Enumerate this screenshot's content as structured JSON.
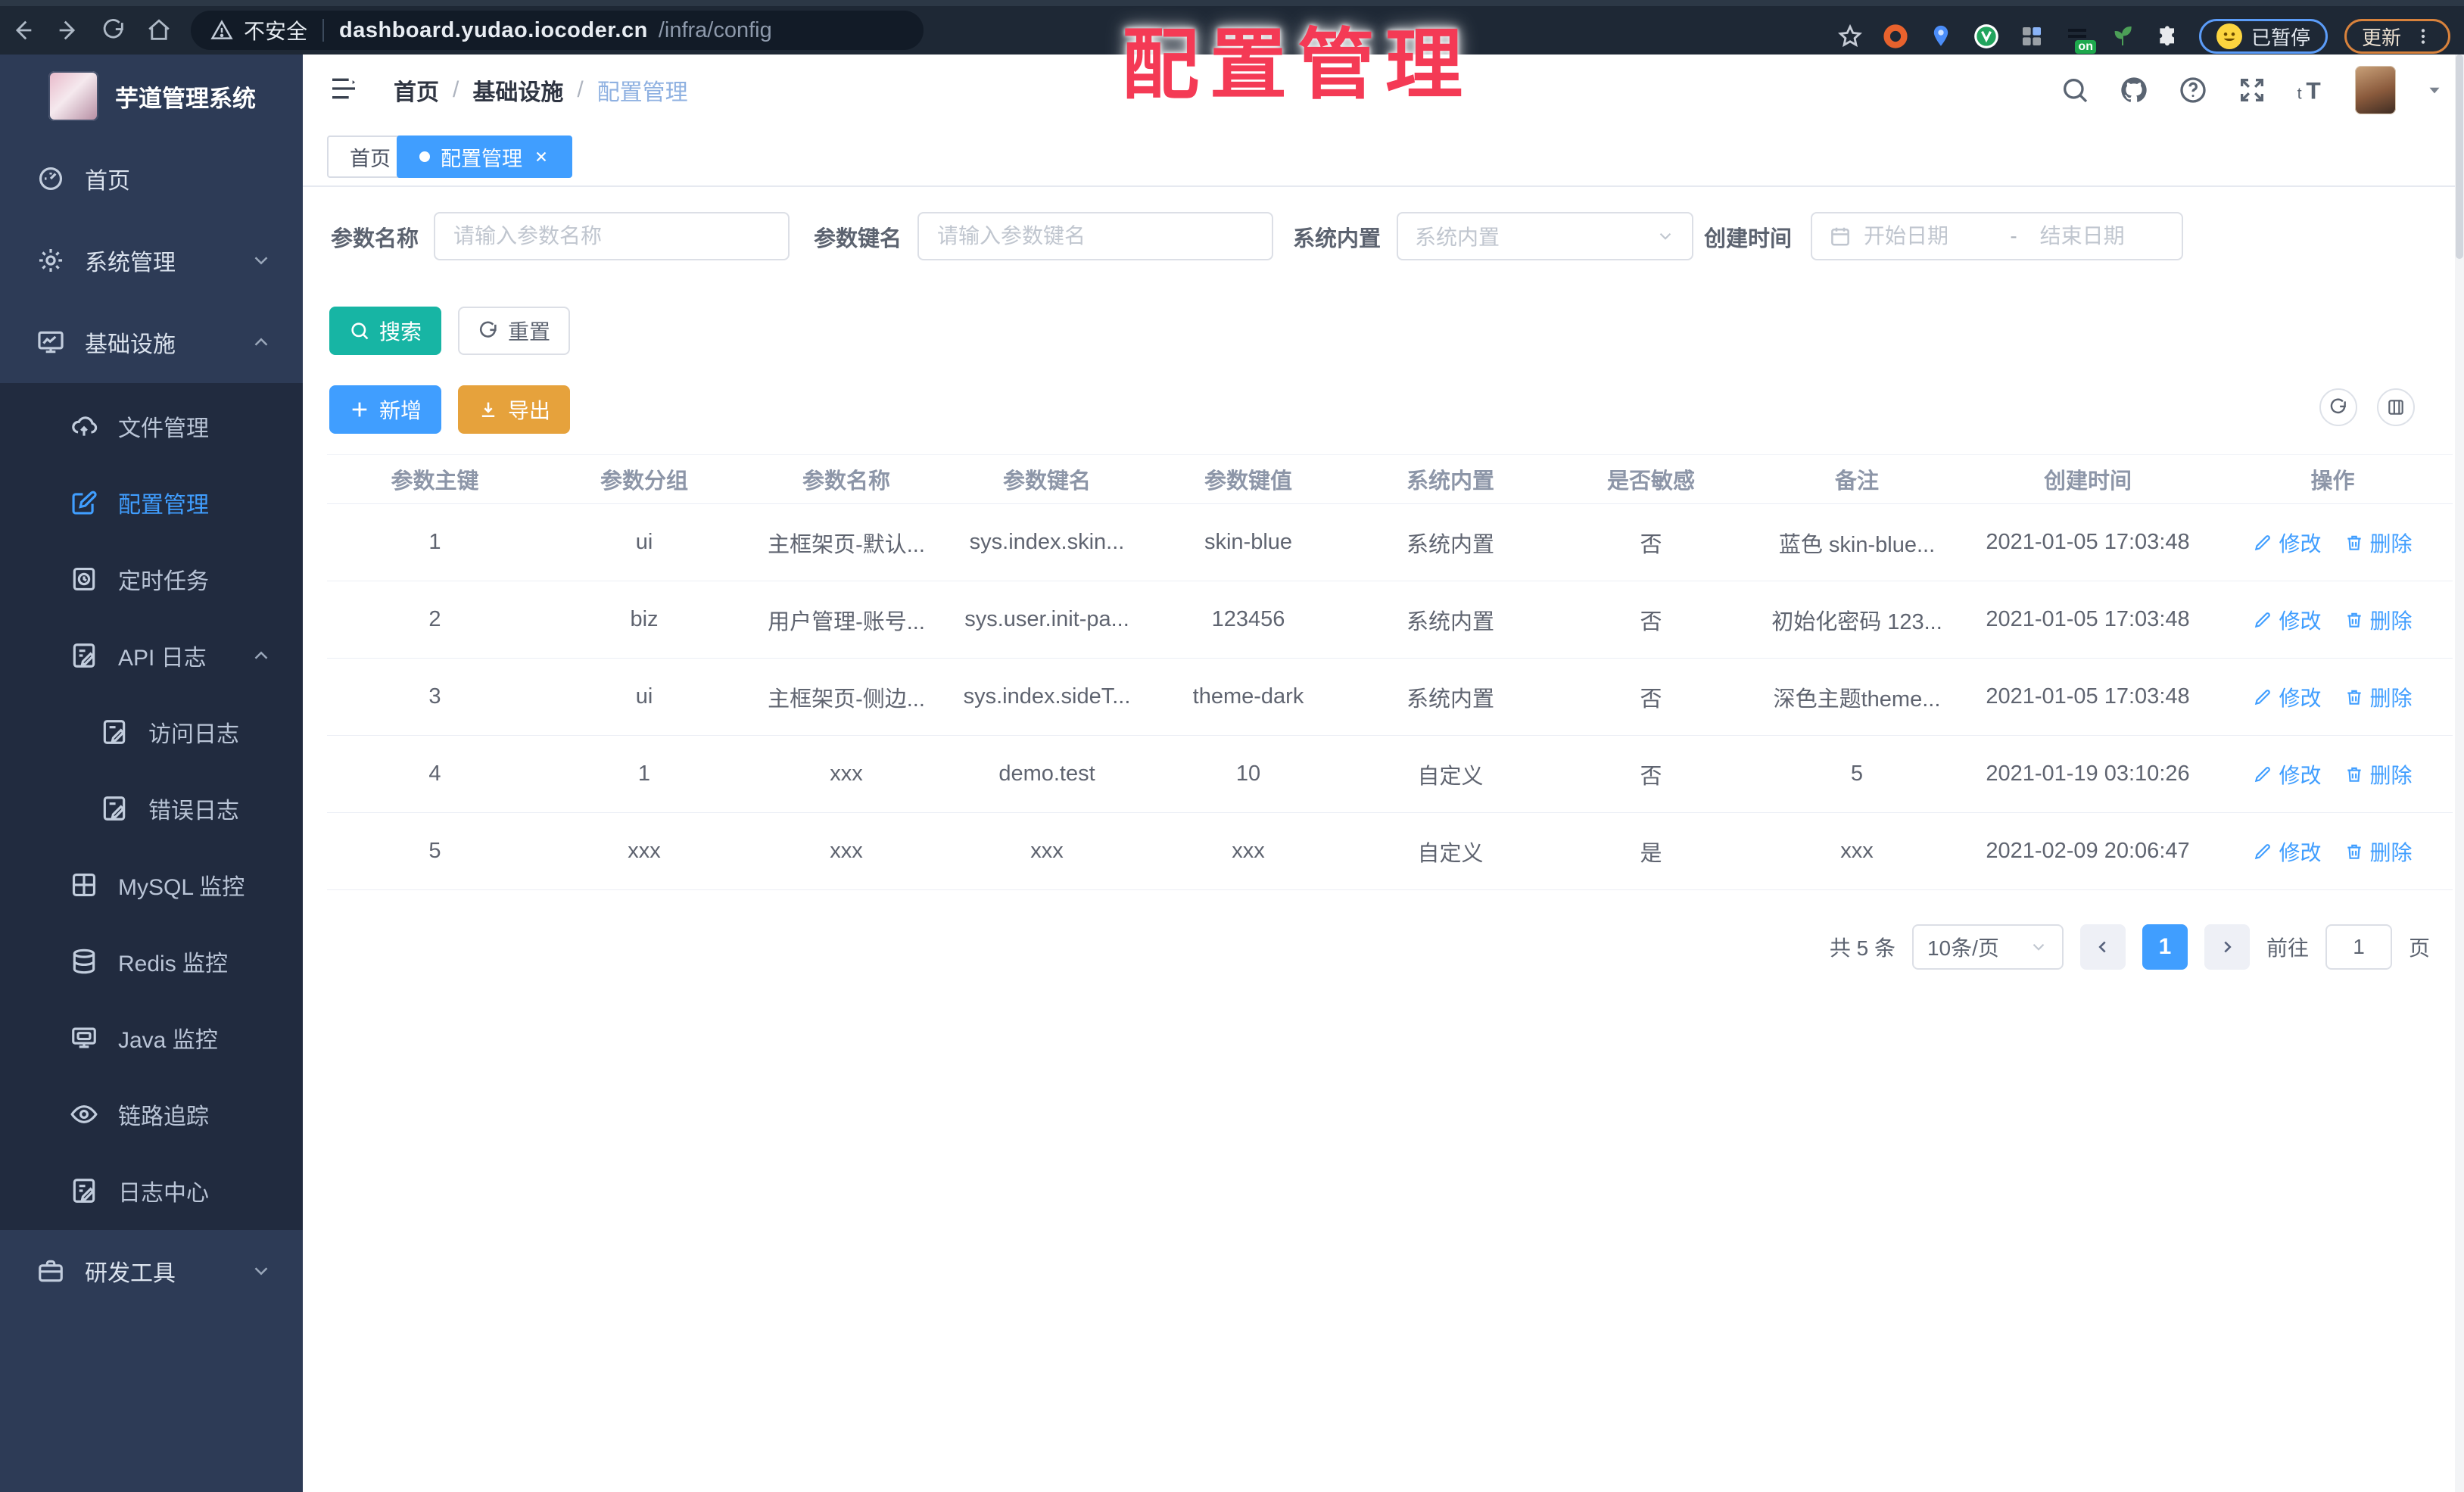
{
  "browser": {
    "security_label": "不安全",
    "url_host": "dashboard.yudao.iocoder.cn",
    "url_path": "/infra/config",
    "extension_on_badge": "on",
    "paused_badge": "已暂停",
    "update_label": "更新"
  },
  "stamp": {
    "text": "配置管理",
    "color": "#f43a55"
  },
  "sidebar": {
    "logo_title": "芋道管理系统",
    "items": [
      {
        "label": "首页"
      },
      {
        "label": "系统管理"
      },
      {
        "label": "基础设施"
      },
      {
        "label": "文件管理"
      },
      {
        "label": "配置管理"
      },
      {
        "label": "定时任务"
      },
      {
        "label": "API 日志"
      },
      {
        "label": "访问日志"
      },
      {
        "label": "错误日志"
      },
      {
        "label": "MySQL 监控"
      },
      {
        "label": "Redis 监控"
      },
      {
        "label": "Java 监控"
      },
      {
        "label": "链路追踪"
      },
      {
        "label": "日志中心"
      },
      {
        "label": "研发工具"
      }
    ]
  },
  "header": {
    "breadcrumb": [
      "首页",
      "基础设施",
      "配置管理"
    ]
  },
  "tabs": {
    "home": "首页",
    "current": "配置管理"
  },
  "filters": {
    "name_label": "参数名称",
    "name_placeholder": "请输入参数名称",
    "key_label": "参数键名",
    "key_placeholder": "请输入参数键名",
    "builtin_label": "系统内置",
    "builtin_placeholder": "系统内置",
    "time_label": "创建时间",
    "date_start": "开始日期",
    "date_sep": "-",
    "date_end": "结束日期"
  },
  "toolbar": {
    "search": "搜索",
    "reset": "重置",
    "add": "新增",
    "export": "导出"
  },
  "table": {
    "columns": [
      "参数主键",
      "参数分组",
      "参数名称",
      "参数键名",
      "参数键值",
      "系统内置",
      "是否敏感",
      "备注",
      "创建时间",
      "操作"
    ],
    "edit_label": "修改",
    "delete_label": "删除",
    "rows": [
      {
        "cells": [
          "1",
          "ui",
          "主框架页-默认...",
          "sys.index.skin...",
          "skin-blue",
          "系统内置",
          "否",
          "蓝色 skin-blue...",
          "2021-01-05 17:03:48"
        ]
      },
      {
        "cells": [
          "2",
          "biz",
          "用户管理-账号...",
          "sys.user.init-pa...",
          "123456",
          "系统内置",
          "否",
          "初始化密码 123...",
          "2021-01-05 17:03:48"
        ]
      },
      {
        "cells": [
          "3",
          "ui",
          "主框架页-侧边...",
          "sys.index.sideT...",
          "theme-dark",
          "系统内置",
          "否",
          "深色主题theme...",
          "2021-01-05 17:03:48"
        ]
      },
      {
        "cells": [
          "4",
          "1",
          "xxx",
          "demo.test",
          "10",
          "自定义",
          "否",
          "5",
          "2021-01-19 03:10:26"
        ]
      },
      {
        "cells": [
          "5",
          "xxx",
          "xxx",
          "xxx",
          "xxx",
          "自定义",
          "是",
          "xxx",
          "2021-02-09 20:06:47"
        ]
      }
    ]
  },
  "pagination": {
    "total": "共 5 条",
    "page_size": "10条/页",
    "page": "1",
    "goto_label": "前往",
    "goto_value": "1",
    "page_unit": "页"
  }
}
